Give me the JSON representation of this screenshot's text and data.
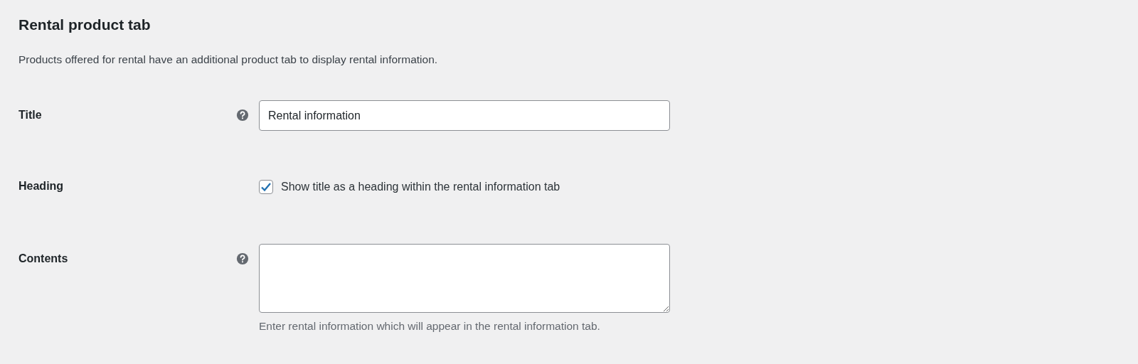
{
  "section": {
    "title": "Rental product tab",
    "description": "Products offered for rental have an additional product tab to display rental information."
  },
  "fields": [
    {
      "kind": "text",
      "label": "Title",
      "help": true,
      "value": "Rental information"
    },
    {
      "kind": "checkbox",
      "label": "Heading",
      "help": false,
      "checked": true,
      "option": "Show title as a heading within the rental information tab"
    },
    {
      "kind": "textarea",
      "label": "Contents",
      "help": true,
      "description": "Enter rental information which will appear in the rental information tab."
    }
  ]
}
